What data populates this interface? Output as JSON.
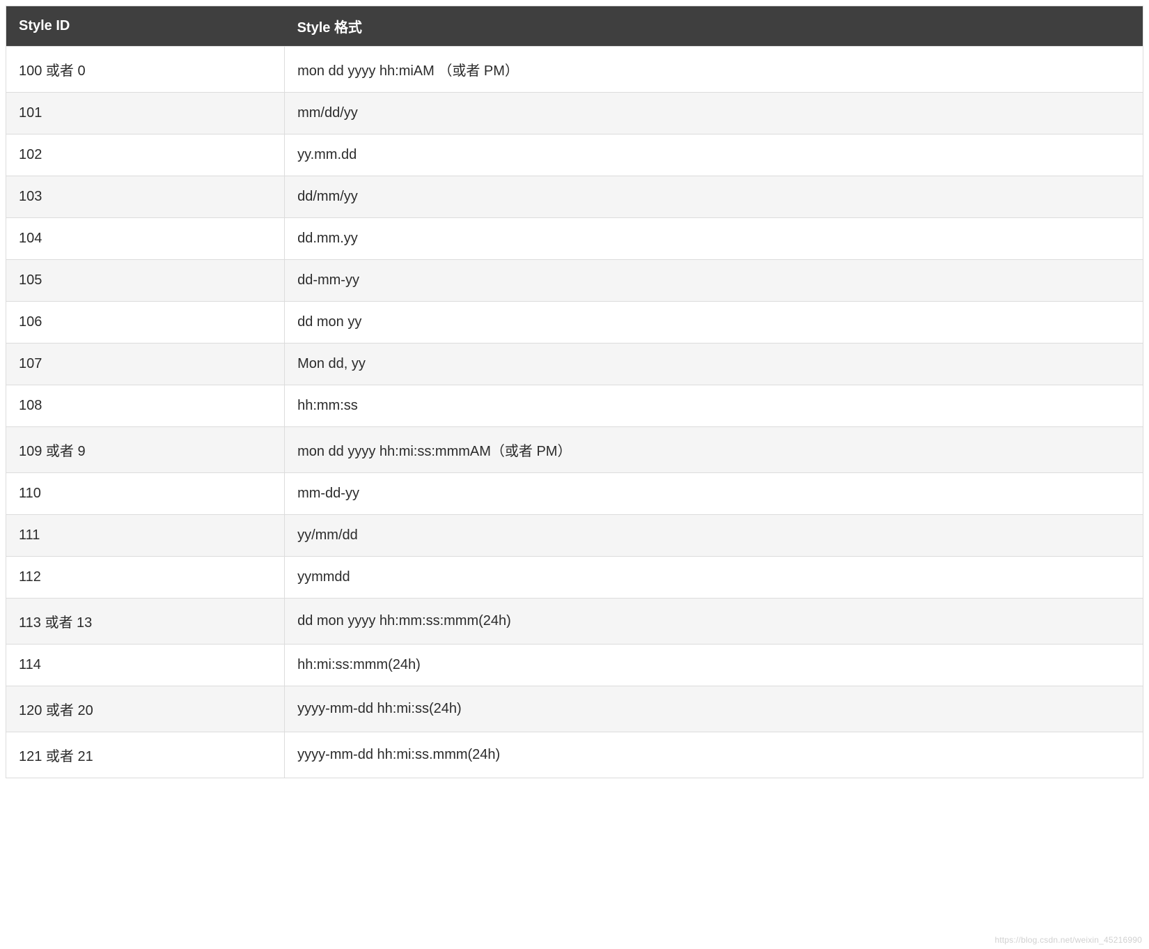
{
  "table": {
    "headers": {
      "style_id": "Style ID",
      "style_format": "Style 格式"
    },
    "rows": [
      {
        "id": "100 或者 0",
        "format": "mon dd yyyy hh:miAM （或者 PM）"
      },
      {
        "id": "101",
        "format": "mm/dd/yy"
      },
      {
        "id": "102",
        "format": "yy.mm.dd"
      },
      {
        "id": "103",
        "format": "dd/mm/yy"
      },
      {
        "id": "104",
        "format": "dd.mm.yy"
      },
      {
        "id": "105",
        "format": "dd-mm-yy"
      },
      {
        "id": "106",
        "format": "dd mon yy"
      },
      {
        "id": "107",
        "format": "Mon dd, yy"
      },
      {
        "id": "108",
        "format": "hh:mm:ss"
      },
      {
        "id": "109 或者 9",
        "format": "mon dd yyyy hh:mi:ss:mmmAM（或者 PM）"
      },
      {
        "id": "110",
        "format": "mm-dd-yy"
      },
      {
        "id": "111",
        "format": "yy/mm/dd"
      },
      {
        "id": "112",
        "format": "yymmdd"
      },
      {
        "id": "113 或者 13",
        "format": "dd mon yyyy hh:mm:ss:mmm(24h)"
      },
      {
        "id": "114",
        "format": "hh:mi:ss:mmm(24h)"
      },
      {
        "id": "120 或者 20",
        "format": "yyyy-mm-dd hh:mi:ss(24h)"
      },
      {
        "id": "121 或者 21",
        "format": "yyyy-mm-dd hh:mi:ss.mmm(24h)"
      }
    ]
  },
  "watermark": "https://blog.csdn.net/weixin_45216990"
}
